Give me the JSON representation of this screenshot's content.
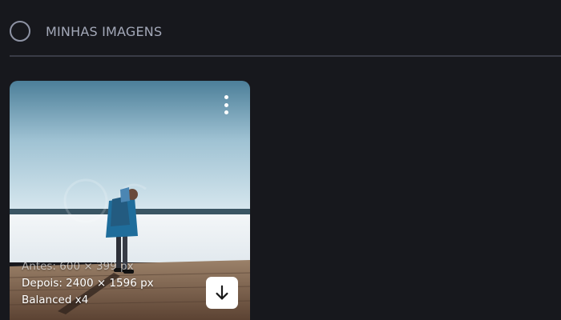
{
  "header": {
    "title": "MINHAS IMAGENS"
  },
  "card": {
    "before_label": "Antes:",
    "before_size": "600 × 399 px",
    "after_label": "Depois:",
    "after_size": "2400 × 1596 px",
    "mode": "Balanced x4"
  },
  "icons": {
    "select": "circle-select-icon",
    "menu": "more-vertical-icon",
    "download": "download-arrow-icon"
  },
  "colors": {
    "background": "#17181d",
    "title": "#a3a8b8",
    "divider": "#3a3c47",
    "button": "#ffffff"
  }
}
